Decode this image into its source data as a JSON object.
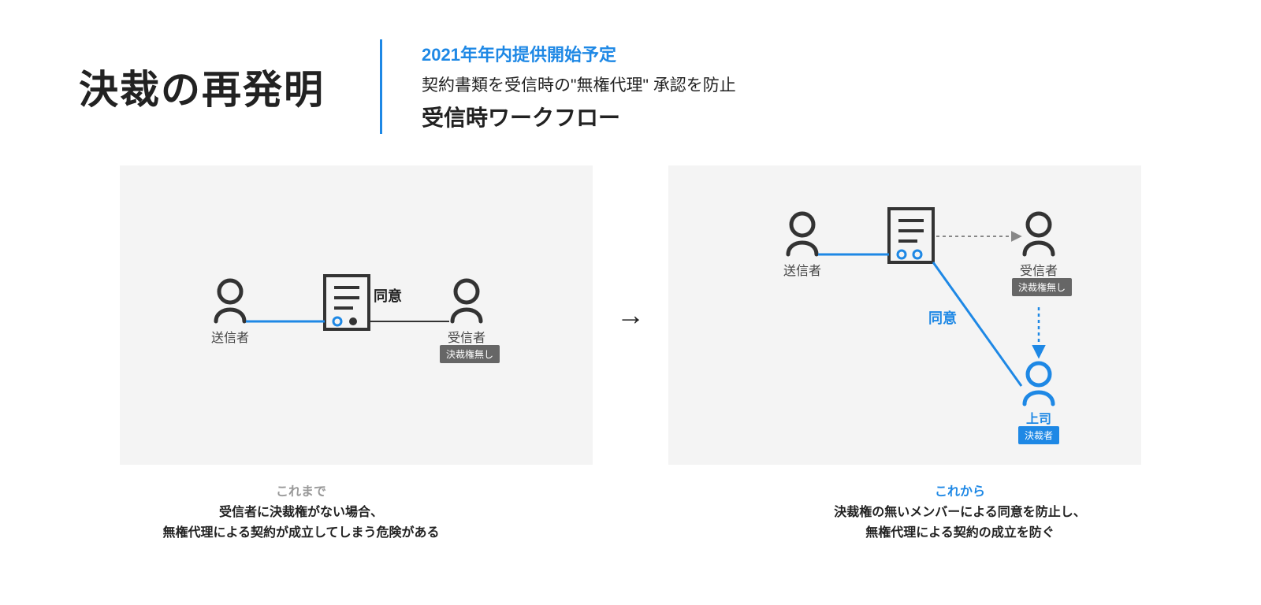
{
  "header": {
    "title": "決裁の再発明",
    "subtitle_blue": "2021年年内提供開始予定",
    "subtitle_desc": "契約書類を受信時の\"無権代理\" 承認を防止",
    "subtitle_bold": "受信時ワークフロー"
  },
  "arrow_between": "→",
  "left_panel": {
    "sender_label": "送信者",
    "receiver_label": "受信者",
    "receiver_badge": "決裁権無し",
    "agree_label": "同意"
  },
  "right_panel": {
    "sender_label": "送信者",
    "receiver_label": "受信者",
    "receiver_badge": "決裁権無し",
    "boss_label": "上司",
    "boss_badge": "決裁者",
    "agree_label": "同意"
  },
  "captions": {
    "left": {
      "label": "これまで",
      "text1": "受信者に決裁権がない場合、",
      "text2": "無権代理による契約が成立してしまう危険がある"
    },
    "right": {
      "label": "これから",
      "text1": "決裁権の無いメンバーによる同意を防止し、",
      "text2": "無権代理による契約の成立を防ぐ"
    }
  },
  "colors": {
    "accent": "#1E88E5",
    "gray_badge": "#666666"
  }
}
